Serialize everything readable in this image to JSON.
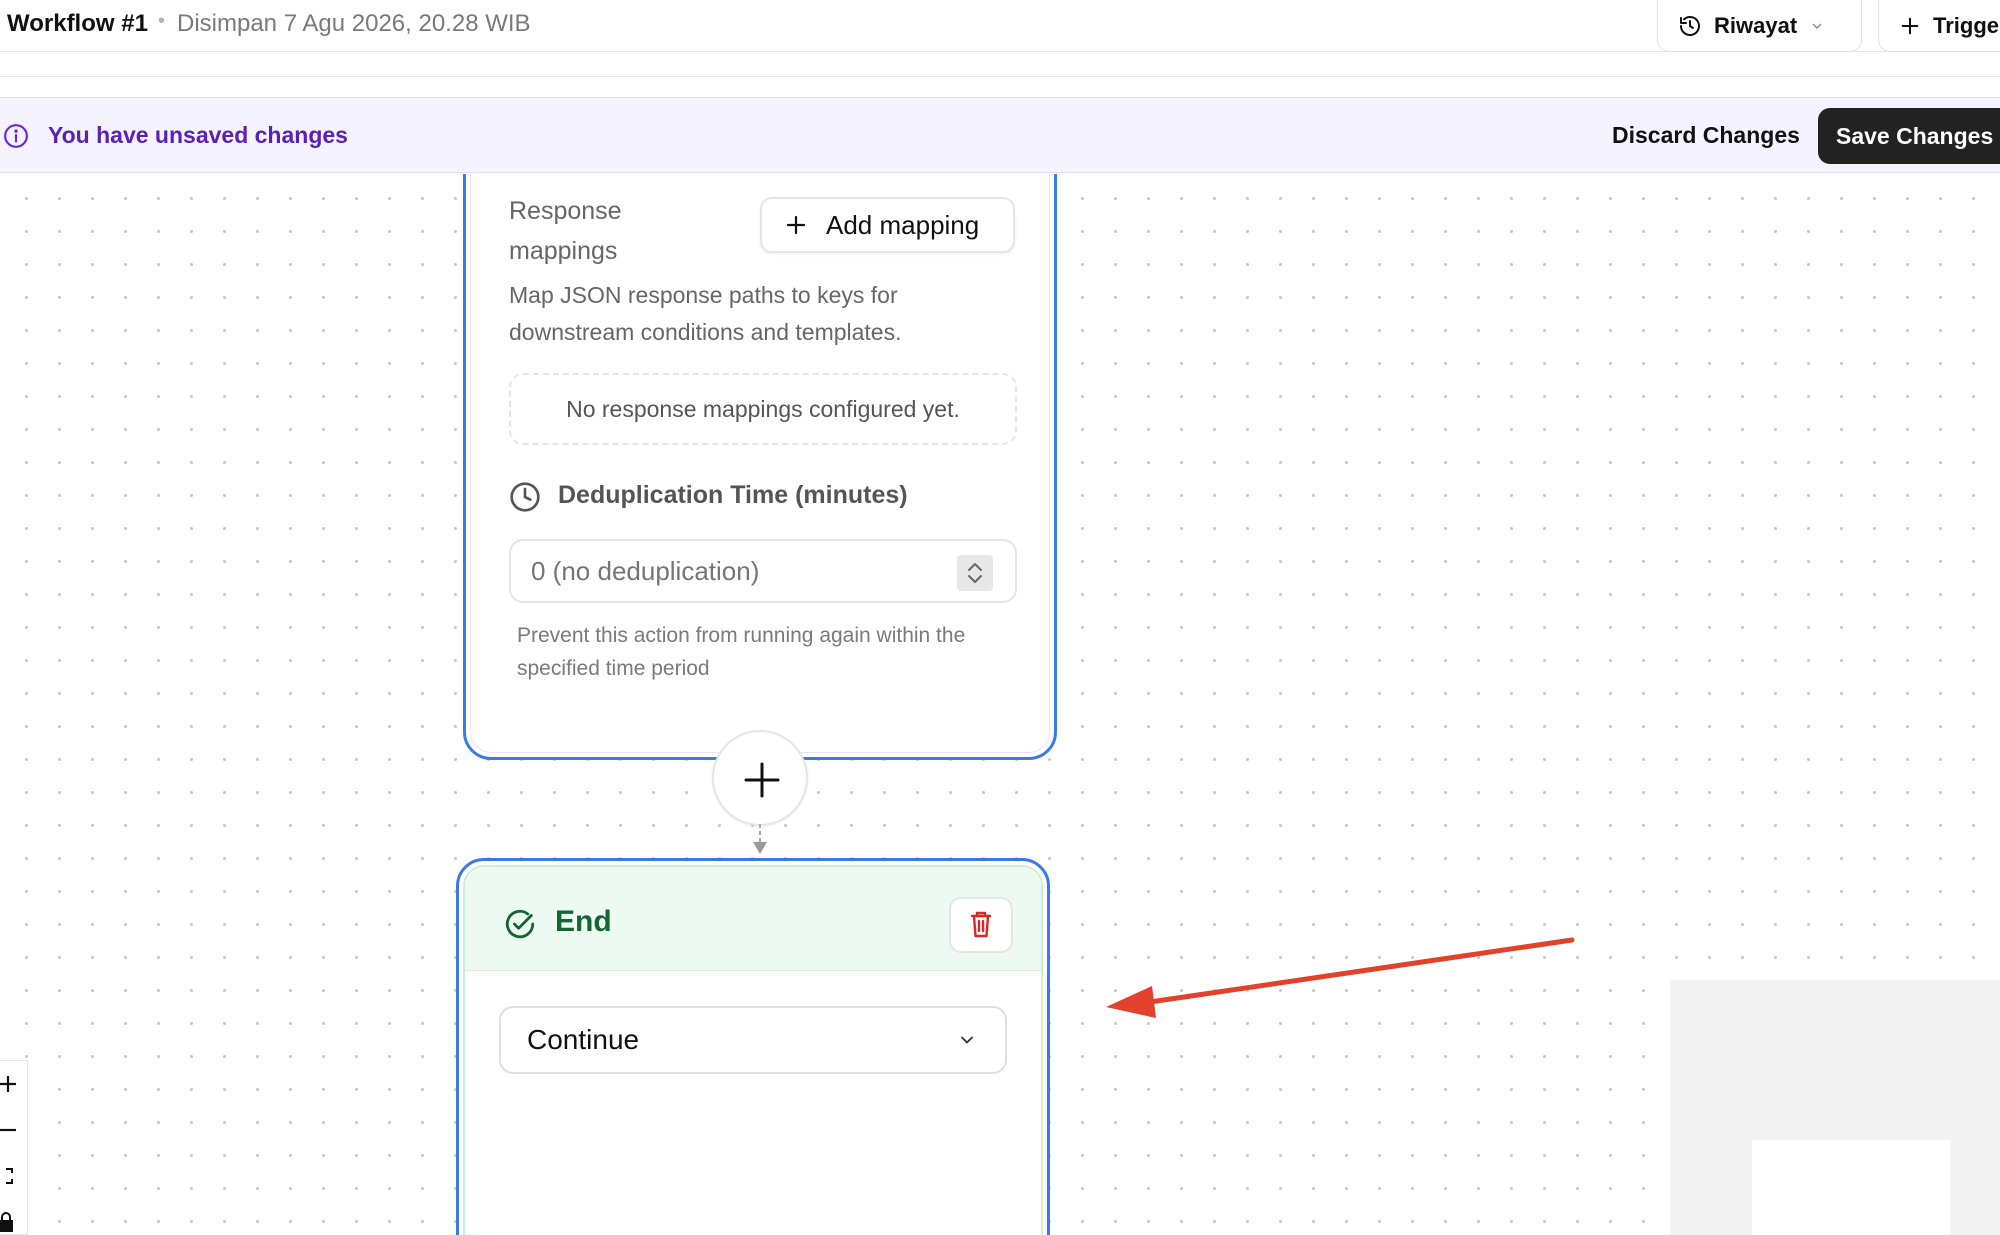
{
  "header": {
    "title": "Workflow #1",
    "separator": "•",
    "saved_status": "Disimpan 7 Agu 2026, 20.28 WIB",
    "history_label": "Riwayat",
    "trigger_label": "Trigge"
  },
  "banner": {
    "message": "You have unsaved changes",
    "discard_label": "Discard Changes",
    "save_label": "Save Changes",
    "accent": "#5b21b6"
  },
  "webhook_node": {
    "response_mappings_label": "Response mappings",
    "add_mapping_label": "Add mapping",
    "response_description": "Map JSON response paths to keys for downstream conditions and templates.",
    "empty_mappings": "No response mappings configured yet.",
    "dedup_label": "Deduplication Time (minutes)",
    "dedup_placeholder": "0 (no deduplication)",
    "dedup_help": "Prevent this action from running again within the specified time period"
  },
  "end_node": {
    "title": "End",
    "selected_option": "Continue",
    "header_color": "#166534"
  },
  "colors": {
    "node_border": "#3b7be9",
    "annotation_arrow": "#e2412b"
  }
}
